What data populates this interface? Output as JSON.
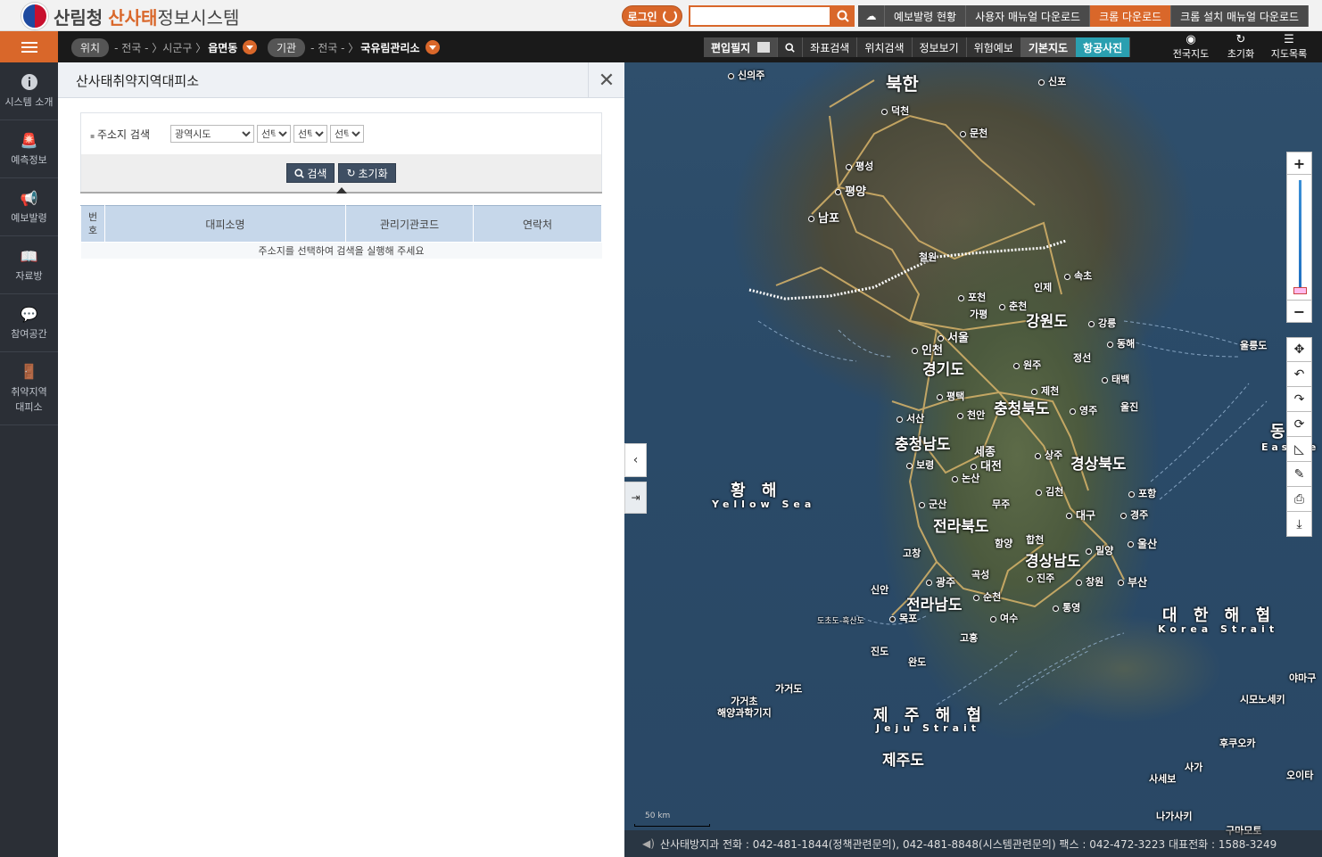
{
  "header": {
    "org_name": "산림청",
    "system_name_highlight": "산사태",
    "system_name_rest": "정보시스템",
    "login_label": "로그인",
    "search_value": "",
    "menu": [
      "예보발령 현황",
      "사용자 매뉴얼 다운로드",
      "크롬 다운로드",
      "크롬 설치 매뉴얼 다운로드"
    ]
  },
  "nav": {
    "location": {
      "tag": "위치",
      "path": "- 전국 - 〉시군구 〉",
      "current": "읍면동"
    },
    "agency": {
      "tag": "기관",
      "path": "- 전국 - 〉",
      "current": "국유림관리소"
    },
    "buttons": [
      "편입필지",
      "좌표검색",
      "위치검색",
      "정보보기",
      "위험예보",
      "기본지도",
      "항공사진"
    ],
    "icon_buttons": [
      {
        "label": "전국지도",
        "icon": "eye-icon"
      },
      {
        "label": "초기화",
        "icon": "refresh-icon"
      },
      {
        "label": "지도목록",
        "icon": "list-icon"
      }
    ]
  },
  "sidebar": {
    "items": [
      {
        "label": "시스템 소개",
        "icon": "info-icon"
      },
      {
        "label": "예측정보",
        "icon": "alarm-icon"
      },
      {
        "label": "예보발령",
        "icon": "megaphone-icon"
      },
      {
        "label": "자료방",
        "icon": "book-icon"
      },
      {
        "label": "참여공간",
        "icon": "chat-icon"
      },
      {
        "label": "취약지역\n대피소",
        "icon": "exit-icon"
      }
    ]
  },
  "panel": {
    "title": "산사태취약지역대피소",
    "search_label": "주소지 검색",
    "selects": [
      "광역시도",
      "선택",
      "선택",
      "선택"
    ],
    "search_button": "검색",
    "reset_button": "초기화",
    "columns": [
      "번\n호",
      "대피소명",
      "관리기관코드",
      "연락처"
    ],
    "empty_message": "주소지를 선택하여 검색을 실행해 주세요"
  },
  "map": {
    "labels": {
      "north_korea": "북한",
      "sinuiju": "신의주",
      "sinpo": "신포",
      "deokcheon": "덕천",
      "munchon": "문천",
      "pyongsong": "평성",
      "pyongyang": "평양",
      "nampo": "남포",
      "cheorwon": "철원",
      "sokcho": "속초",
      "inje": "인제",
      "pocheon": "포천",
      "gapyeong": "가평",
      "chuncheon": "춘천",
      "gangwon": "강원도",
      "gangneung": "강릉",
      "donghae": "동해",
      "ulleungdo": "울릉도",
      "seoul": "서울",
      "incheon": "인천",
      "gyeonggi": "경기도",
      "wonju": "원주",
      "jeongseon": "정선",
      "taebaek": "태백",
      "pyeongtaek": "평택",
      "jecheon": "제천",
      "cheonan": "천안",
      "chungbuk": "충청북도",
      "yeongju": "영주",
      "uljin": "울진",
      "seosan": "서산",
      "chungnam": "충청남도",
      "sejong": "세종",
      "daejeon": "대전",
      "boryeong": "보령",
      "sangju": "상주",
      "gyeongbuk": "경상북도",
      "nonsan": "논산",
      "gimcheon": "김천",
      "pohang": "포항",
      "yellow_sea": "황 해",
      "yellow_sea_en": "Yellow Sea",
      "gunsan": "군산",
      "muju": "무주",
      "jeonbuk": "전라북도",
      "daegu": "대구",
      "gyeongju": "경주",
      "hamyang": "함양",
      "hapcheon": "합천",
      "miryang": "밀양",
      "ulsan": "울산",
      "gochang": "고창",
      "gyeongnam": "경상남도",
      "gokseong": "곡성",
      "gwangju": "광주",
      "jinju": "진주",
      "changwon": "창원",
      "busan": "부산",
      "sinan": "신안",
      "jeonnam": "전라남도",
      "suncheon": "순천",
      "tongyeong": "통영",
      "mokpo": "목포",
      "yeosu": "여수",
      "doch_heuksan": "도초도-흑산도",
      "goheung": "고흥",
      "jindo": "진도",
      "wando": "완도",
      "korea_strait": "대 한 해 협",
      "korea_strait_en": "Korea Strait",
      "gageodo": "가거도",
      "gageodo_base": "가거초\n해양과학기지",
      "jeju_strait": "제 주 해 협",
      "jeju_strait_en": "Jeju Strait",
      "jeju": "제주도",
      "yamaguchi": "야마구",
      "shimonoseki": "시모노세키",
      "fukuoka": "후쿠오카",
      "saga": "사가",
      "sasebo": "사세보",
      "oita": "오이타",
      "nagasaki": "나가사키",
      "kumamoto": "구마모토",
      "east_sea_partial": "동",
      "east_sea_en_partial": "E a s t  S e"
    },
    "scale_label": "50 km"
  },
  "footer": {
    "text": "산사태방지과 전화 : 042-481-1844(정책관련문의), 042-481-8848(시스템관련문의) 팩스 : 042-472-3223 대표전화 : 1588-3249"
  },
  "colors": {
    "accent": "#d9672a",
    "dark_bar": "#1a1a1a",
    "sidebar": "#2b2f36",
    "air_photo_tab": "#2a9fb0",
    "table_header": "#c6d7ea"
  }
}
